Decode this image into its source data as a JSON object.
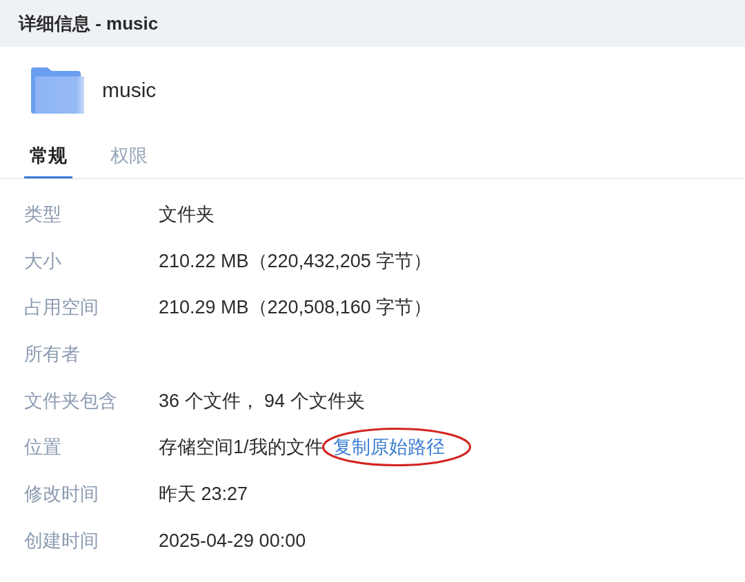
{
  "header": {
    "title": "详细信息 - music"
  },
  "item": {
    "kind": "folder",
    "name": "music"
  },
  "tabs": [
    {
      "label": "常规",
      "selected": true
    },
    {
      "label": "权限",
      "selected": false
    }
  ],
  "properties": [
    {
      "label": "类型",
      "value": "文件夹"
    },
    {
      "label": "大小",
      "value": "210.22 MB（220,432,205 字节）"
    },
    {
      "label": "占用空间",
      "value": "210.29 MB（220,508,160 字节）"
    },
    {
      "label": "所有者"
    },
    {
      "label": "文件夹包含",
      "value": "36 个文件， 94 个文件夹"
    },
    {
      "label": "位置",
      "value": "存储空间1/我的文件",
      "link": {
        "label": "复制原始路径",
        "circled": true
      }
    },
    {
      "label": "修改时间",
      "value": "昨天 23:27"
    },
    {
      "label": "创建时间",
      "value": "2025-04-29 00:00"
    }
  ]
}
